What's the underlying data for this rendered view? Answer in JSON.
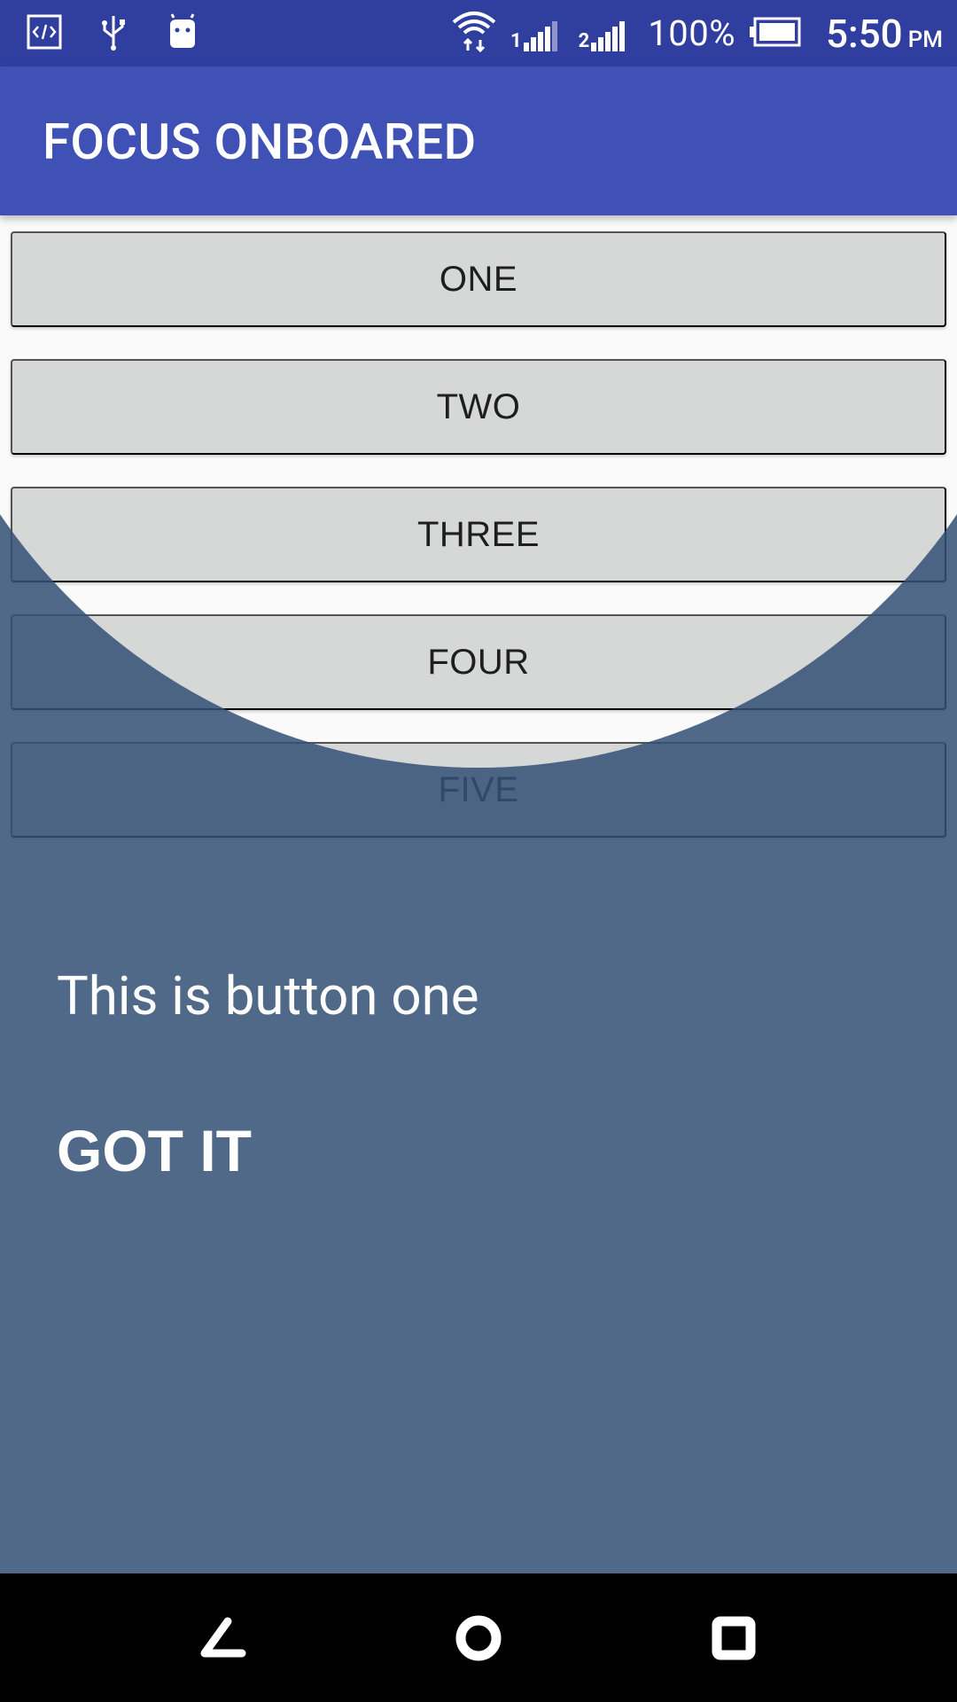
{
  "status_bar": {
    "icons": [
      "code-icon",
      "usb-icon",
      "android-icon",
      "wifi-icon",
      "signal-icon",
      "signal-icon",
      "battery-icon"
    ],
    "sim1": "1",
    "sim2": "2",
    "battery": "100%",
    "time": "5:50",
    "ampm": "PM"
  },
  "app_bar": {
    "title": "FOCUS ONBOARED"
  },
  "buttons": [
    {
      "label": "ONE"
    },
    {
      "label": "TWO"
    },
    {
      "label": "THREE"
    },
    {
      "label": "FOUR"
    },
    {
      "label": "FIVE"
    }
  ],
  "onboarding": {
    "description": "This is button one",
    "got_it_label": "GOT IT"
  },
  "nav_bar": {
    "icons": [
      "back-icon",
      "home-icon",
      "recents-icon"
    ]
  },
  "colors": {
    "primary": "#3f51b5",
    "primary_dark": "#303f9f",
    "overlay": "#345076",
    "button_bg": "#d6d7d7"
  }
}
